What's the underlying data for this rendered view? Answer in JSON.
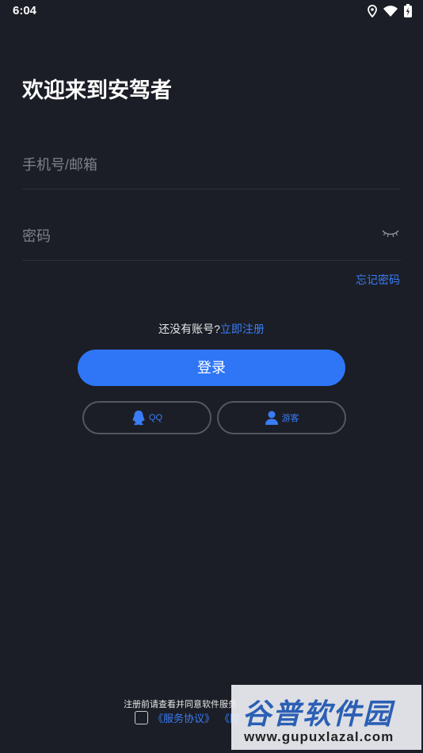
{
  "status_bar": {
    "time": "6:04"
  },
  "welcome": {
    "title": "欢迎来到安驾者"
  },
  "form": {
    "phone_placeholder": "手机号/邮箱",
    "password_placeholder": "密码",
    "forgot_label": "忘记密码"
  },
  "register": {
    "question": "还没有账号?",
    "link": "立即注册"
  },
  "login_label": "登录",
  "alt_login": {
    "qq_label": "QQ",
    "guest_label": "游客"
  },
  "agreement": {
    "notice": "注册前请查看并同意软件服务",
    "service_link": "《服务协议》",
    "privacy_link": "《隐"
  },
  "watermark": {
    "brand": "谷普软件园",
    "url": "www.gupuxlazal.com"
  },
  "colors": {
    "background": "#1b1e26",
    "accent": "#2f76f6",
    "link": "#3a7cf6"
  },
  "icons": [
    "location-icon",
    "wifi-icon",
    "battery-icon",
    "eye-closed-icon",
    "qq-icon",
    "guest-user-icon"
  ]
}
